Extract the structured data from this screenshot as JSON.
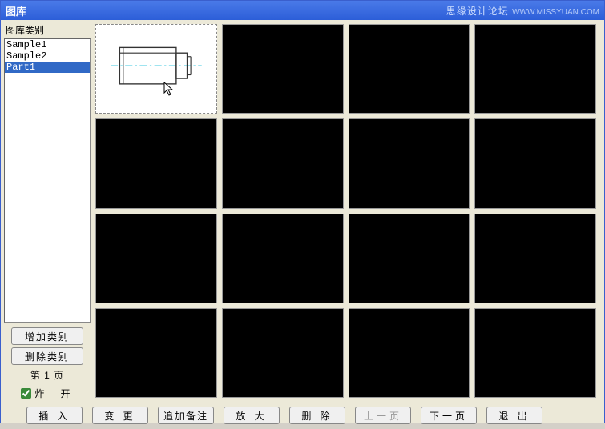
{
  "title": "图库",
  "watermark_text": "思缘设计论坛",
  "watermark_url": "WWW.MISSYUAN.COM",
  "sidebar": {
    "label": "图库类别",
    "items": [
      "Sample1",
      "Sample2",
      "Part1"
    ],
    "selected_index": 2,
    "add_button": "增加类别",
    "delete_button": "删除类别",
    "page_text": "第 1 页",
    "checkbox_label": "炸　开",
    "checkbox_checked": true
  },
  "grid": {
    "selected_index": 0,
    "cell_count": 16
  },
  "bottom": {
    "insert": "插 入",
    "change": "变 更",
    "add_note": "追加备注",
    "zoom": "放 大",
    "delete": "删 除",
    "prev_page": "上一页",
    "next_page": "下一页",
    "exit": "退 出"
  }
}
